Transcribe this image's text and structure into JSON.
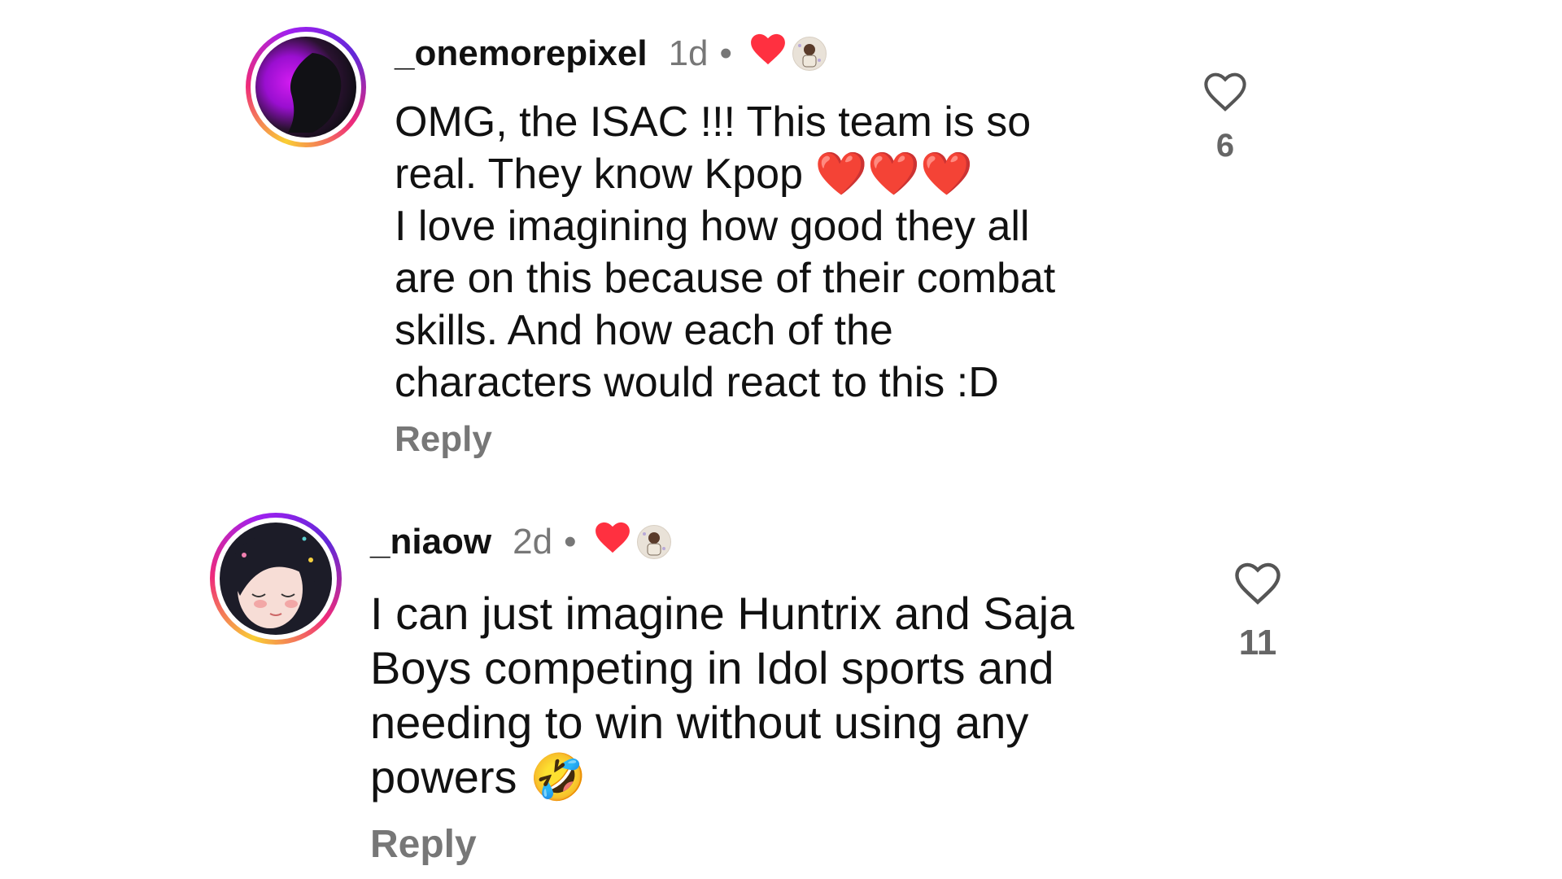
{
  "comments": [
    {
      "username": "_onemorepixel",
      "time": "1d",
      "separator": "•",
      "text": "OMG, the ISAC !!! This team is so\nreal. They know Kpop ❤️❤️❤️\nI love imagining how good they all\nare on this because of their combat\nskills. And how each of the\ncharacters would react to this :D",
      "reply_label": "Reply",
      "like_count": "6",
      "liked_by_creator": true,
      "heart_color": "#ff3040"
    },
    {
      "username": "_niaow",
      "time": "2d",
      "separator": "•",
      "text": "I can just imagine Huntrix and Saja\nBoys competing in Idol sports and\nneeding to win without using any\npowers 🤣",
      "reply_label": "Reply",
      "like_count": "11",
      "liked_by_creator": true,
      "heart_color": "#ff3040"
    }
  ],
  "icons": {
    "like": "heart-outline-icon",
    "creator_like": "heart-filled-icon"
  }
}
